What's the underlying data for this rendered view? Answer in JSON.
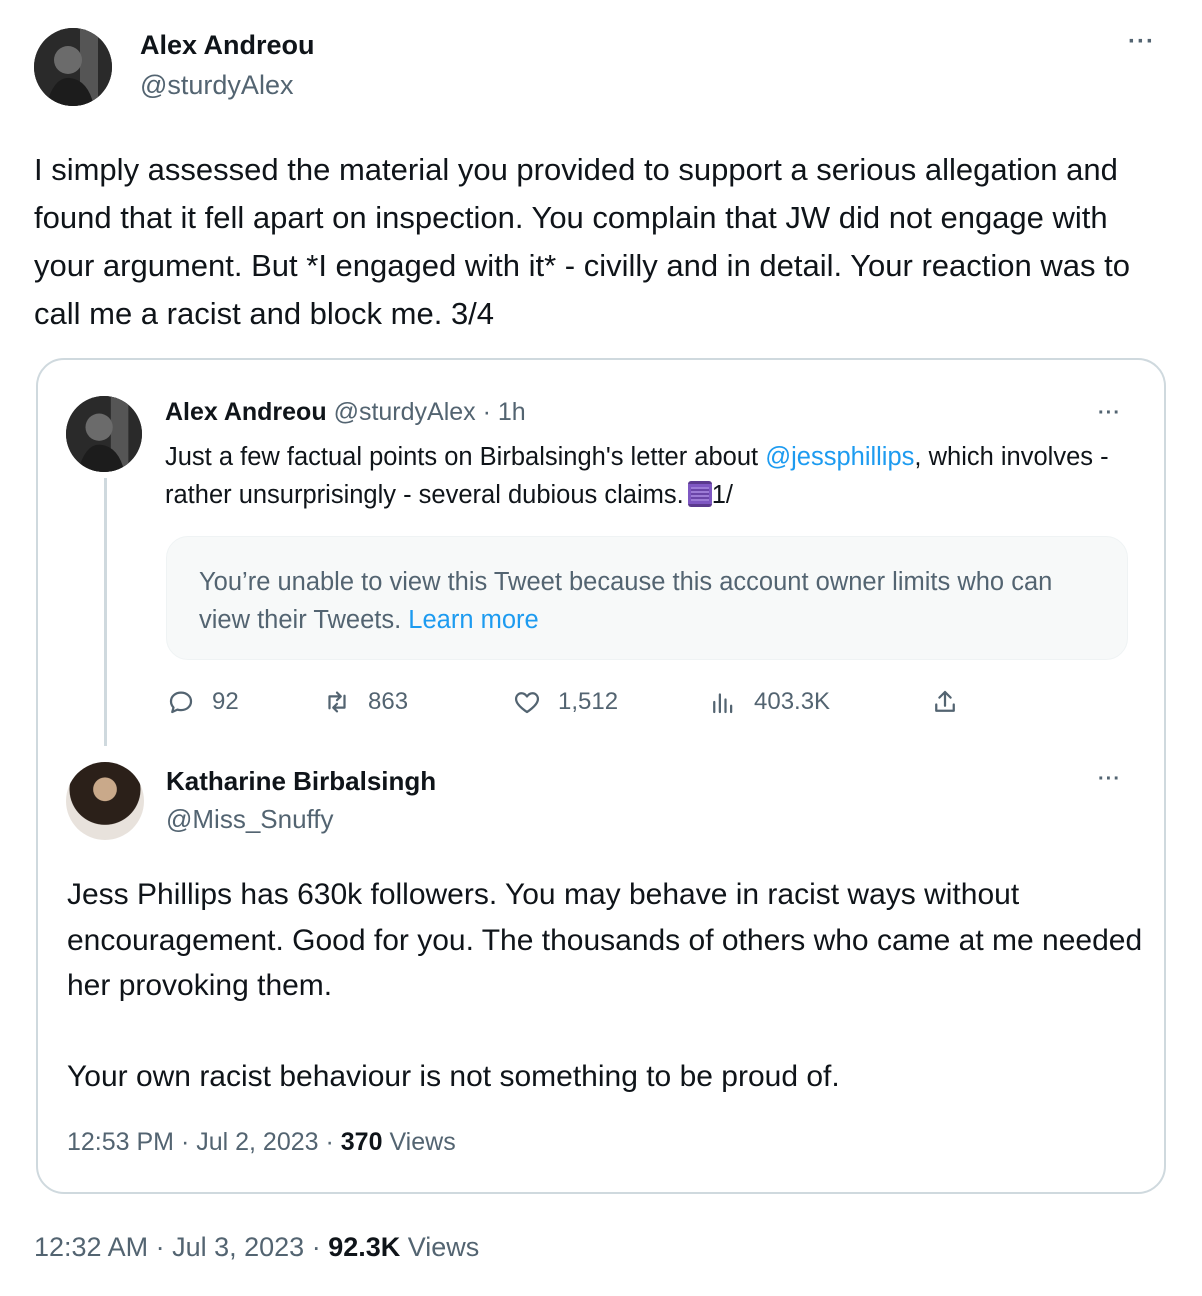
{
  "main_tweet": {
    "author_name": "Alex Andreou",
    "author_handle": "@sturdyAlex",
    "text": "I simply assessed the material you provided to support a serious allegation and found that it fell apart on inspection. You complain that JW did not engage with your argument. But *I engaged with it* - civilly and in detail. Your reaction was to call me a racist and block me. 3/4",
    "time": "12:32 AM",
    "date": "Jul 3, 2023",
    "views_count": "92.3K",
    "views_label": "Views",
    "more_icon": "more-dots-icon"
  },
  "quoted_thread": {
    "first": {
      "author_name": "Alex Andreou",
      "author_handle": "@sturdyAlex",
      "age": "1h",
      "text_before": "Just a few factual points on Birbalsingh's letter about ",
      "mention": "@jessphillips",
      "text_after": ", which involves - rather unsurprisingly - several dubious claims.",
      "text_suffix": "1/",
      "emoji": "spool-of-thread",
      "notice_text": "You’re unable to view this Tweet because this account owner limits who can view their Tweets.",
      "notice_link": "Learn more",
      "stats": {
        "replies": "92",
        "retweets": "863",
        "likes": "1,512",
        "views": "403.3K"
      }
    },
    "reply": {
      "author_name": "Katharine Birbalsingh",
      "author_handle": "@Miss_Snuffy",
      "paragraph1": "Jess Phillips has 630k followers. You may behave in racist ways without encouragement. Good for you. The thousands of others who came at me needed her provoking them.",
      "paragraph2": "Your own racist behaviour is not something to be proud of.",
      "time": "12:53 PM",
      "date": "Jul 2, 2023",
      "views_count": "370",
      "views_label": "Views"
    }
  },
  "colors": {
    "text": "#0f1419",
    "secondary": "#536471",
    "link": "#1d9bf0",
    "border": "#cfd9de"
  }
}
